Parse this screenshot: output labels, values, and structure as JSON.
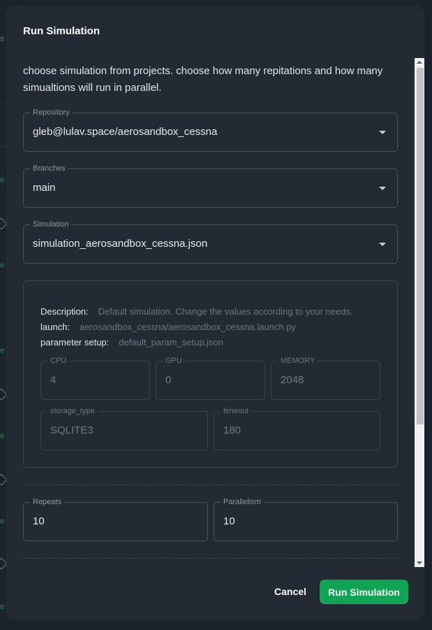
{
  "dialog": {
    "title": "Run Simulation",
    "intro": "choose simulation from projects. choose how many repitations and how many simualtions will run in parallel."
  },
  "repository": {
    "label": "Repository",
    "value": "gleb@lulav.space/aerosandbox_cessna"
  },
  "branches": {
    "label": "Branches",
    "value": "main"
  },
  "simulation": {
    "label": "Simulation",
    "value": "simulation_aerosandbox_cessna.json"
  },
  "details": {
    "description_label": "Description:",
    "description_value": "Default simulation. Change the values according to your needs.",
    "launch_label": "launch:",
    "launch_value": "aerosandbox_cessna/aerosandbox_cessna.launch.py",
    "param_label": "parameter setup:",
    "param_value": "default_param_setup.json",
    "cpu": {
      "label": "CPU",
      "value": "4"
    },
    "gpu": {
      "label": "GPU",
      "value": "0"
    },
    "memory": {
      "label": "MEMORY",
      "value": "2048"
    },
    "storage_type": {
      "label": "storage_type",
      "value": "SQLITE3"
    },
    "timeout": {
      "label": "timeout",
      "value": "180"
    }
  },
  "repeats": {
    "label": "Repeats",
    "value": "10"
  },
  "parallelism": {
    "label": "Parallelism",
    "value": "10"
  },
  "actions": {
    "cancel": "Cancel",
    "run": "Run Simulation"
  },
  "background": {
    "letter": "e",
    "s": "s"
  },
  "colors": {
    "accent": "#0fa554",
    "dialog_bg": "#222b33",
    "page_bg": "#1b2229"
  }
}
